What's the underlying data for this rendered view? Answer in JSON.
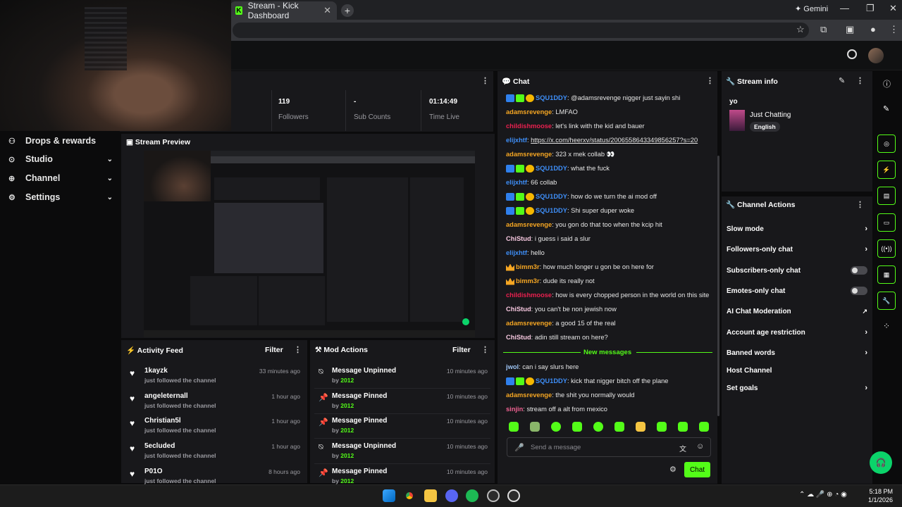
{
  "browser": {
    "tab_title": "Stream - Kick Dashboard",
    "gemini": "Gemini",
    "fav_letter": "K"
  },
  "sidebar": [
    {
      "label": "Drops & rewards",
      "icon": "drops-icon"
    },
    {
      "label": "Studio",
      "icon": "studio-icon"
    },
    {
      "label": "Channel",
      "icon": "channel-icon"
    },
    {
      "label": "Settings",
      "icon": "settings-icon"
    }
  ],
  "stats": [
    {
      "value": "119",
      "label": "Followers"
    },
    {
      "value": "-",
      "label": "Sub Counts"
    },
    {
      "value": "01:14:49",
      "label": "Time Live"
    }
  ],
  "preview": {
    "title": "Stream Preview"
  },
  "activity": {
    "title": "Activity Feed",
    "filter": "Filter",
    "items": [
      {
        "name": "1kayzk",
        "sub": "just followed the channel",
        "time": "33 minutes ago"
      },
      {
        "name": "angeleternall",
        "sub": "just followed the channel",
        "time": "1 hour ago"
      },
      {
        "name": "Christian5l",
        "sub": "just followed the channel",
        "time": "1 hour ago"
      },
      {
        "name": "5ecluded",
        "sub": "just followed the channel",
        "time": "1 hour ago"
      },
      {
        "name": "P01O",
        "sub": "just followed the channel",
        "time": "8 hours ago"
      }
    ]
  },
  "mod": {
    "title": "Mod Actions",
    "filter": "Filter",
    "items": [
      {
        "name": "Message Unpinned",
        "by": "by",
        "user": "2012",
        "time": "10 minutes ago"
      },
      {
        "name": "Message Pinned",
        "by": "by",
        "user": "2012",
        "time": "10 minutes ago"
      },
      {
        "name": "Message Pinned",
        "by": "by",
        "user": "2012",
        "time": "10 minutes ago"
      },
      {
        "name": "Message Unpinned",
        "by": "by",
        "user": "2012",
        "time": "10 minutes ago"
      },
      {
        "name": "Message Pinned",
        "by": "by",
        "user": "2012",
        "time": "10 minutes ago"
      }
    ]
  },
  "chat": {
    "title": "Chat",
    "new_messages": "New messages",
    "placeholder": "Send a message",
    "send": "Chat",
    "messages": [
      {
        "user": "SQU1DDY",
        "color": "#3e8ef7",
        "badges": "mod",
        "text": "@adamsrevenge nigger just sayin shi"
      },
      {
        "user": "adamsrevenge",
        "color": "#f5a623",
        "badges": "",
        "text": "LMFAO"
      },
      {
        "user": "childishmoose",
        "color": "#e9204f",
        "badges": "",
        "text": "let's link with the kid and bauer"
      },
      {
        "user": "elijxhtf",
        "color": "#3e8ef7",
        "badges": "",
        "text": "https://x.com/heerxv/status/2006558643349856257?s=20"
      },
      {
        "user": "adamsrevenge",
        "color": "#f5a623",
        "badges": "",
        "text": "323 x mek collab 👀"
      },
      {
        "user": "SQU1DDY",
        "color": "#3e8ef7",
        "badges": "mod",
        "text": "what the fuck"
      },
      {
        "user": "elijxhtf",
        "color": "#3e8ef7",
        "badges": "",
        "text": "66 collab"
      },
      {
        "user": "SQU1DDY",
        "color": "#3e8ef7",
        "badges": "mod",
        "text": "how do we turn the ai mod off"
      },
      {
        "user": "SQU1DDY",
        "color": "#3e8ef7",
        "badges": "mod",
        "text": "Shi super duper woke"
      },
      {
        "user": "adamsrevenge",
        "color": "#f5a623",
        "badges": "",
        "text": "you gon do that too when the kcip hit"
      },
      {
        "user": "ChiStud",
        "color": "#f7c8e0",
        "badges": "",
        "text": "i guess i said a slur"
      },
      {
        "user": "elijxhtf",
        "color": "#3e8ef7",
        "badges": "",
        "text": "hello"
      },
      {
        "user": "bimm3r",
        "color": "#f5a623",
        "badges": "crown",
        "text": "how much longer u gon be on here for"
      },
      {
        "user": "bimm3r",
        "color": "#f5a623",
        "badges": "crown",
        "text": "dude its really not"
      },
      {
        "user": "childishmoose",
        "color": "#e9204f",
        "badges": "",
        "text": "how is every chopped person in the world on this site"
      },
      {
        "user": "ChiStud",
        "color": "#f7c8e0",
        "badges": "",
        "text": "you can't be non jewish now"
      },
      {
        "user": "adamsrevenge",
        "color": "#f5a623",
        "badges": "",
        "text": "a good 15 of the real"
      },
      {
        "user": "ChiStud",
        "color": "#f7c8e0",
        "badges": "",
        "text": "adin still stream on here?"
      },
      {
        "user": "jwol",
        "color": "#9ec5f5",
        "badges": "",
        "text": "can i say slurs here"
      },
      {
        "user": "SQU1DDY",
        "color": "#3e8ef7",
        "badges": "mod",
        "text": "kick that nigger bitch off the plane"
      },
      {
        "user": "adamsrevenge",
        "color": "#f5a623",
        "badges": "",
        "text": "the shit you normally would"
      },
      {
        "user": "sinjin",
        "color": "#f06292",
        "badges": "",
        "text": "stream off a alt from mexico"
      }
    ]
  },
  "stream_info": {
    "title": "Stream info",
    "stream_title": "yo",
    "category": "Just Chatting",
    "language": "English"
  },
  "channel_actions": {
    "title": "Channel Actions",
    "items": [
      {
        "label": "Slow mode",
        "type": "chevron"
      },
      {
        "label": "Followers-only chat",
        "type": "chevron"
      },
      {
        "label": "Subscribers-only chat",
        "type": "toggle"
      },
      {
        "label": "Emotes-only chat",
        "type": "toggle"
      },
      {
        "label": "AI Chat Moderation",
        "type": "external"
      },
      {
        "label": "Account age restriction",
        "type": "chevron"
      },
      {
        "label": "Banned words",
        "type": "chevron"
      },
      {
        "label": "Host Channel",
        "type": "none"
      },
      {
        "label": "Set goals",
        "type": "chevron"
      }
    ]
  },
  "clock": {
    "time": "5:18 PM",
    "date": "1/1/2026"
  },
  "colors": {
    "accent": "#53fc18",
    "panel": "#18181b",
    "bg": "#0b0b0c"
  }
}
